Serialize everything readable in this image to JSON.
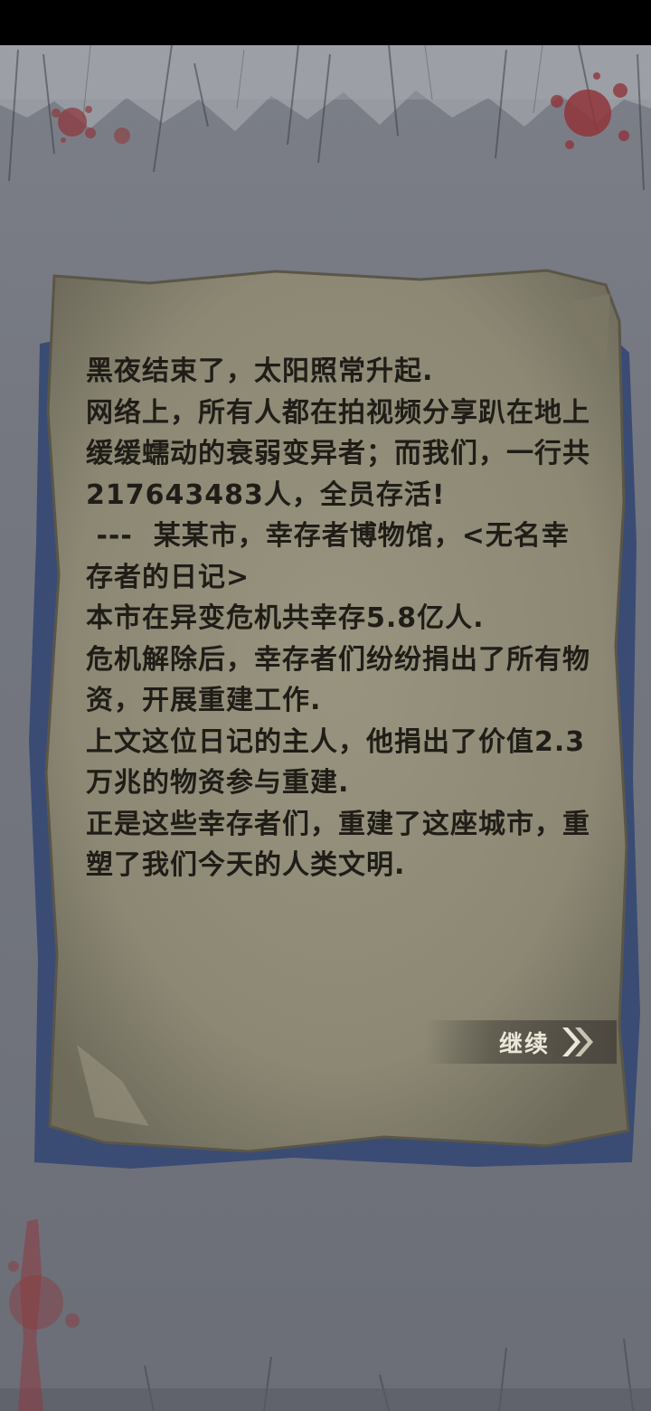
{
  "diary": {
    "text": "黑夜结束了，太阳照常升起.\n网络上，所有人都在拍视频分享趴在地上缓缓蠕动的衰弱变异者；而我们，一行共217643483人，全员存活!\n ---  某某市，幸存者博物馆，<无名幸存者的日记>\n本市在异变危机共幸存5.8亿人.\n危机解除后，幸存者们纷纷捐出了所有物资，开展重建工作.\n上文这位日记的主人，他捐出了价值2.3万兆的物资参与重建.\n正是这些幸存者们，重建了这座城市，重塑了我们今天的人类文明."
  },
  "continue_button": {
    "label": "继续",
    "icon": "double-chevron-right-icon"
  },
  "colors": {
    "background": "#737680",
    "paper": "#8f8b79",
    "paper_edge": "#3a4c74",
    "text": "#1f1d17",
    "blood": "#8c3a3e",
    "button": "#4c4840"
  }
}
